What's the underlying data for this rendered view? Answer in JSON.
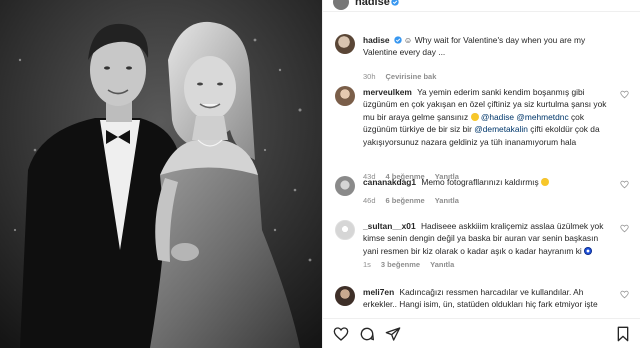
{
  "post": {
    "username": "hadise",
    "caption_user": "hadise",
    "caption_text": "Why wait for Valentine's day when you are my Valentine every day ...",
    "caption_emoji": "☺",
    "caption_time": "30h",
    "translate_label": "Çevirisine bak"
  },
  "comments": [
    {
      "user": "merveulkem",
      "text_a": "Ya yemin ederim sanki kendim boşanmış gibi üzgünüm en çok yakışan en özel çiftiniz ya siz kurtulma şansı yok mu bir araya gelme şansınız",
      "mention1": "@hadise",
      "mention2": "@mehmetdnc",
      "text_b": "çok üzgünüm türkiye de bir siz bir",
      "mention3": "@demetakalin",
      "text_c": "çifti ekoldür çok da yakışıyorsunuz nazara geldiniz ya tüh inanamıyorum hala",
      "time": "43d",
      "likes": "4 beğenme",
      "reply": "Yanıtla"
    },
    {
      "user": "cananakdag1",
      "text_a": "Memo fotografllarınızı kaldırmış",
      "time": "46d",
      "likes": "6 beğenme",
      "reply": "Yanıtla"
    },
    {
      "user": "_sultan__x01",
      "text_a": "Hadiseee askkiiim kraliçemiz asslaa üzülmek yok kimse senin dengin değil ya baska bir auran var senin başkasın yani resmen bir kiz olarak o kadar aşık o kadar hayranım ki",
      "time": "1s",
      "likes": "3 beğenme",
      "reply": "Yanıtla"
    },
    {
      "user": "meli7en",
      "text_a": "Kadıncağızı ressmen harcadılar ve kullandılar. Ah erkekler.. Hangi isim, ün, statüden oldukları hiç fark etmiyor işte"
    }
  ],
  "icons": {
    "like": "heart-icon",
    "comment": "comment-icon",
    "share": "share-icon",
    "save": "bookmark-icon",
    "verified": "verified-badge-icon",
    "comment_like": "heart-icon"
  },
  "colors": {
    "mention": "#00376b",
    "verified": "#3897f0",
    "muted": "#8e8e8e"
  }
}
